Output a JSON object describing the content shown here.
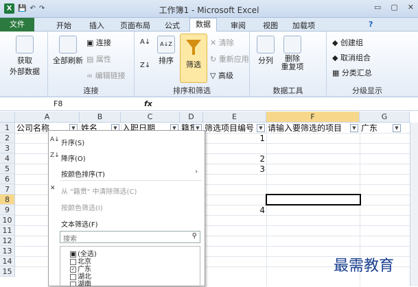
{
  "window": {
    "title": "工作簿1 - Microsoft Excel",
    "controls": [
      "▭",
      "▢",
      "✕"
    ]
  },
  "quick_access": {
    "logo": "X",
    "save": "💾",
    "undo": "↶",
    "redo": "↷"
  },
  "tabs": [
    "文件",
    "开始",
    "插入",
    "页面布局",
    "公式",
    "数据",
    "审阅",
    "视图",
    "加载项"
  ],
  "ribbon_right": {
    "help": "?"
  },
  "ribbon": {
    "get_data": "获取\n外部数据",
    "refresh_all": "全部刷新",
    "connections": "连接",
    "properties": "属性",
    "edit_links": "编辑链接",
    "group_connections": "连接",
    "sort_az": "A↓Z",
    "sort": "排序",
    "filter": "筛选",
    "clear": "清除",
    "reapply": "重新应用",
    "advanced": "高级",
    "group_sort_filter": "排序和筛选",
    "text_to_columns": "分列",
    "remove_duplicates": "删除\n重复项",
    "group_data_tools": "数据工具",
    "group": "创建组",
    "ungroup": "取消组合",
    "subtotal": "分类汇总",
    "group_outline": "分级显示"
  },
  "formula_bar": {
    "cell_ref": "F8",
    "fx": "fx"
  },
  "columns": [
    "A",
    "B",
    "C",
    "D",
    "E",
    "F",
    "G"
  ],
  "rows": [
    "1",
    "2",
    "3",
    "4",
    "5",
    "6",
    "7",
    "8",
    "9",
    "10",
    "11",
    "12",
    "13",
    "14",
    "15"
  ],
  "headers": {
    "A": "公司名称",
    "B": "姓名",
    "C": "入职日期",
    "D": "籍贯",
    "E": "筛选项目编号",
    "F": "请输入要筛选的项目",
    "G": "广东"
  },
  "e_values": {
    "r2": "1",
    "r4": "2",
    "r5": "3",
    "r9": "4"
  },
  "menu": {
    "sort_asc": "升序(S)",
    "sort_desc": "降序(O)",
    "sort_color": "按颜色排序(T)",
    "clear_filter": "从 \"籍贯\" 中清除筛选(C)",
    "filter_color": "按颜色筛选(I)",
    "text_filter": "文本筛选(F)",
    "search_placeholder": "搜索",
    "items": [
      "(全选)",
      "北京",
      "广东",
      "湖北",
      "湖南"
    ]
  },
  "watermark": "最需教育"
}
